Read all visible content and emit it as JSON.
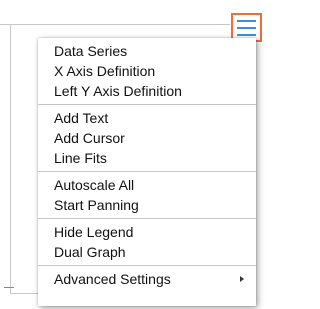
{
  "menu_button": {
    "icon": "hamburger-menu-icon",
    "accent_color": "#3d8fd6",
    "highlight_color": "#ee6d3a"
  },
  "menu": {
    "groups": [
      {
        "items": [
          {
            "label": "Data Series"
          },
          {
            "label": "X Axis Definition"
          },
          {
            "label": "Left Y Axis Definition"
          }
        ]
      },
      {
        "items": [
          {
            "label": "Add Text"
          },
          {
            "label": "Add Cursor"
          },
          {
            "label": "Line Fits"
          }
        ]
      },
      {
        "items": [
          {
            "label": "Autoscale All"
          },
          {
            "label": "Start Panning"
          }
        ]
      },
      {
        "items": [
          {
            "label": "Hide Legend"
          },
          {
            "label": "Dual Graph"
          }
        ]
      },
      {
        "items": [
          {
            "label": "Advanced Settings",
            "submenu": true,
            "submenu_icon": "chevron-right-icon"
          }
        ]
      }
    ]
  }
}
